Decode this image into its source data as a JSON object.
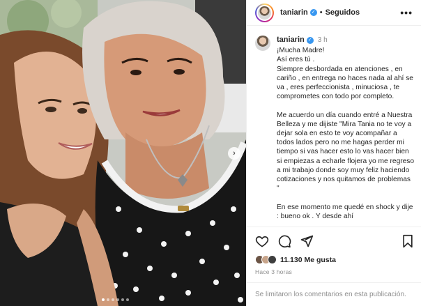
{
  "post": {
    "username": "taniarin",
    "follow_status": "Seguidos",
    "separator": "•",
    "more_label": "•••",
    "verified_glyph": "✓",
    "time_ago": "3 h",
    "caption": "¡Mucha Madre!\nAsí eres tú .\nSiempre desbordada en atenciones , en cariño , en entrega no haces nada al ahí se va , eres perfeccionista , minuciosa , te comprometes con todo por completo.\n\nMe acuerdo un día cuando entré a Nuestra Belleza y me dijiste \"Mira Tania no te voy a dejar sola en esto te voy acompañar a todos lados pero no me hagas perder mi tiempo si vas hacer esto lo vas hacer bien si empiezas a echarle flojera yo me regreso a mi trabajo donde soy muy feliz haciendo cotizaciones y nos quitamos de problemas \"\n\nEn ese momento me quedé en shock y dije : bueno ok . Y desde ahí",
    "likes": "11.130 Me gusta",
    "posted_ago": "Hace 3 horas",
    "comments_disabled": "Se limitaron los comentarios en esta publicación.",
    "next_arrow": "›"
  },
  "icons": {
    "like": "heart-icon",
    "comment": "comment-icon",
    "share": "paper-plane-icon",
    "save": "bookmark-icon"
  },
  "carousel": {
    "total": 6,
    "active": 0
  },
  "colors": {
    "accent": "#3897f0",
    "muted": "#8e8e8e",
    "text": "#262626",
    "border": "#efefef"
  }
}
